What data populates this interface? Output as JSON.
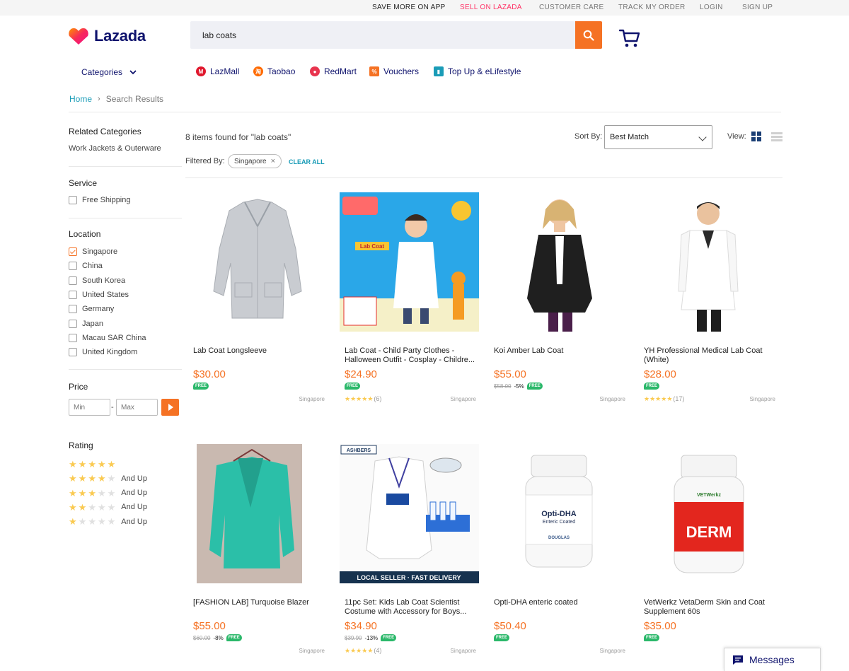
{
  "topbar": {
    "save_more": "SAVE MORE ON APP",
    "sell": "SELL ON LAZADA",
    "customer_care": "CUSTOMER CARE",
    "track_order": "TRACK MY ORDER",
    "login": "LOGIN",
    "signup": "SIGN UP"
  },
  "header": {
    "logo_text": "Lazada",
    "search_value": "lab coats",
    "accent_color": "#f57224",
    "brand_color": "#0f136d"
  },
  "nav": {
    "categories": "Categories",
    "links": [
      {
        "label": "LazMall",
        "icon": "lazmall-icon"
      },
      {
        "label": "Taobao",
        "icon": "taobao-icon"
      },
      {
        "label": "RedMart",
        "icon": "redmart-icon"
      },
      {
        "label": "Vouchers",
        "icon": "vouchers-icon"
      },
      {
        "label": "Top Up & eLifestyle",
        "icon": "topup-icon"
      }
    ]
  },
  "breadcrumb": {
    "home": "Home",
    "current": "Search Results"
  },
  "sidebar": {
    "related_title": "Related Categories",
    "related_item": "Work Jackets & Outerware",
    "service_title": "Service",
    "service_option": "Free Shipping",
    "location_title": "Location",
    "locations": [
      {
        "label": "Singapore",
        "checked": true
      },
      {
        "label": "China",
        "checked": false
      },
      {
        "label": "South Korea",
        "checked": false
      },
      {
        "label": "United States",
        "checked": false
      },
      {
        "label": "Germany",
        "checked": false
      },
      {
        "label": "Japan",
        "checked": false
      },
      {
        "label": "Macau SAR China",
        "checked": false
      },
      {
        "label": "United Kingdom",
        "checked": false
      }
    ],
    "price_title": "Price",
    "price_min_placeholder": "Min",
    "price_max_placeholder": "Max",
    "rating_title": "Rating",
    "and_up": "And Up",
    "ratings": [
      5,
      4,
      3,
      2,
      1
    ]
  },
  "results": {
    "found_text": "8 items found for \"lab coats\"",
    "sort_label": "Sort By:",
    "sort_value": "Best Match",
    "view_label": "View:",
    "filtered_label": "Filtered By:",
    "filter_chip": "Singapore",
    "clear_all": "CLEAR ALL"
  },
  "products": [
    {
      "title": "Lab Coat Longsleeve",
      "price": "$30.00",
      "orig": "",
      "disc": "",
      "rating": null,
      "reviews": "",
      "location": "Singapore",
      "free": "FREE"
    },
    {
      "title": "Lab Coat - Child Party Clothes - Halloween Outfit - Cosplay - Childre...",
      "price": "$24.90",
      "orig": "",
      "disc": "",
      "rating": 5,
      "reviews": "(6)",
      "location": "Singapore",
      "free": "FREE"
    },
    {
      "title": "Koi Amber Lab Coat",
      "price": "$55.00",
      "orig": "$58.00",
      "disc": "-5%",
      "rating": null,
      "reviews": "",
      "location": "Singapore",
      "free": "FREE"
    },
    {
      "title": "YH Professional Medical Lab Coat (White)",
      "price": "$28.00",
      "orig": "",
      "disc": "",
      "rating": 5,
      "reviews": "(17)",
      "location": "Singapore",
      "free": "FREE"
    },
    {
      "title": "[FASHION LAB] Turquoise Blazer",
      "price": "$55.00",
      "orig": "$60.00",
      "disc": "-8%",
      "rating": null,
      "reviews": "",
      "location": "Singapore",
      "free": "FREE"
    },
    {
      "title": "11pc Set: Kids Lab Coat Scientist Costume with Accessory for Boys...",
      "price": "$34.90",
      "orig": "$39.90",
      "disc": "-13%",
      "rating": 5,
      "reviews": "(4)",
      "location": "Singapore",
      "free": "FREE"
    },
    {
      "title": "Opti-DHA enteric coated",
      "price": "$50.40",
      "orig": "",
      "disc": "",
      "rating": null,
      "reviews": "",
      "location": "Singapore",
      "free": "FREE"
    },
    {
      "title": "VetWerkz VetaDerm Skin and Coat Supplement 60s",
      "price": "$35.00",
      "orig": "",
      "disc": "",
      "rating": null,
      "reviews": "",
      "location": "",
      "free": "FREE"
    }
  ],
  "product_images": {
    "img2_badge": "Lab Coat",
    "img6_brand": "ASHBERS",
    "img6_banner": "LOCAL SELLER · FAST DELIVERY",
    "img7_name": "Opti-DHA",
    "img7_sub": "Enteric Coated",
    "img7_brand": "DOUGLAS",
    "img8_brand": "VETWerkz",
    "img8_name": "DERM"
  },
  "messages": {
    "label": "Messages"
  }
}
